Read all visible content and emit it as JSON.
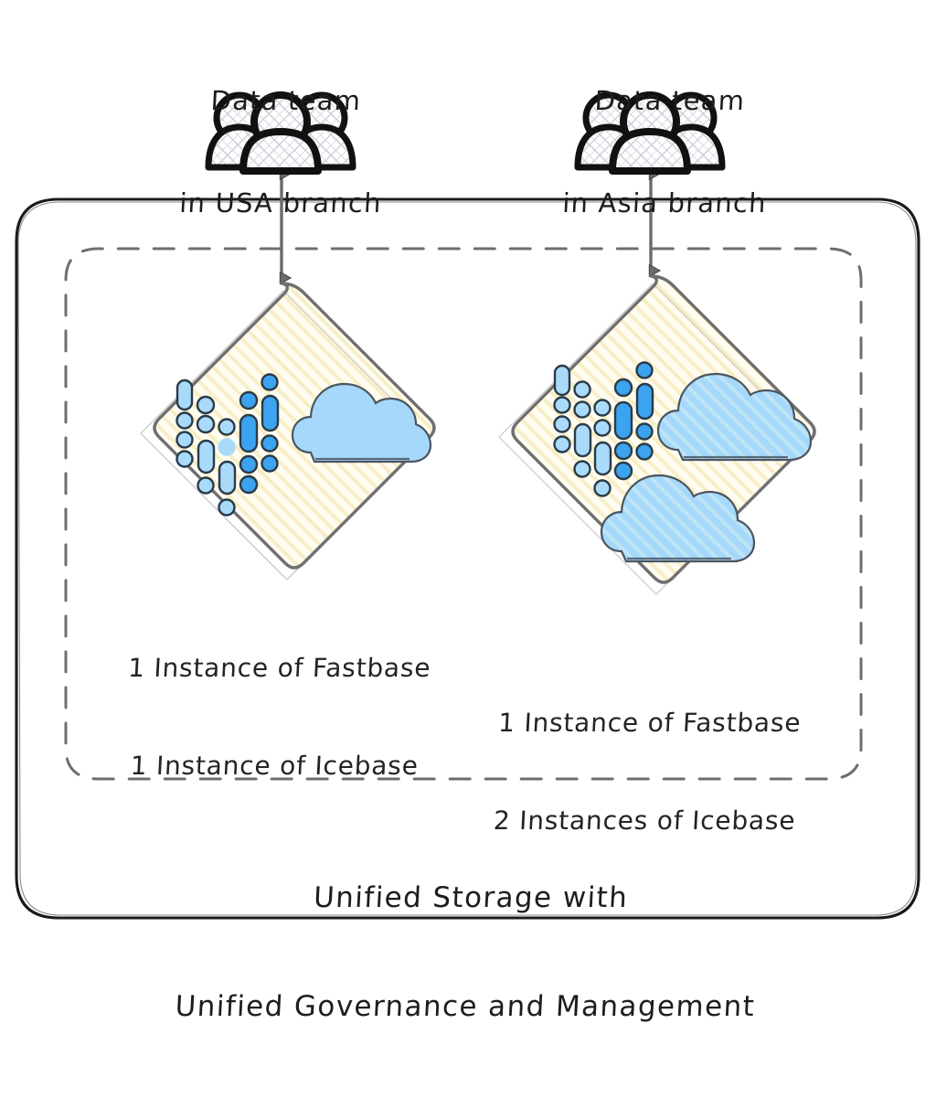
{
  "diagram": {
    "title_caption": {
      "line1": "Unified Storage with",
      "line2": "Unified Governance and Management"
    },
    "teams": [
      {
        "id": "usa",
        "icon": "people-group-icon",
        "label_line1": "Data team",
        "label_line2": "in USA branch"
      },
      {
        "id": "asia",
        "icon": "people-group-icon",
        "label_line1": "Data team",
        "label_line2": "in Asia branch"
      }
    ],
    "regions": [
      {
        "id": "usa",
        "shape": "diamond",
        "icons": [
          "data-dots-icon",
          "cloud-icon"
        ],
        "cloud_count": 1,
        "instances_line1": "1 Instance of Fastbase",
        "instances_line2": "1 Instance of Icebase"
      },
      {
        "id": "asia",
        "shape": "diamond",
        "icons": [
          "data-dots-icon",
          "cloud-icon",
          "cloud-icon"
        ],
        "cloud_count": 2,
        "instances_line1": "1 Instance of Fastbase",
        "instances_line2": "2 Instances of Icebase"
      }
    ],
    "connectors": [
      {
        "id": "usa-connector",
        "style": "double-headed-arrow",
        "from": "team-usa",
        "to": "region-usa"
      },
      {
        "id": "asia-connector",
        "style": "double-headed-arrow",
        "from": "team-asia",
        "to": "region-asia"
      }
    ],
    "containers": {
      "outer": {
        "id": "unified-storage-boundary",
        "border": "solid"
      },
      "inner": {
        "id": "instances-boundary",
        "border": "dashed"
      }
    },
    "colors": {
      "diamond_fill": "#fffdf2",
      "diamond_hatch": "#f6e7b4",
      "diamond_stroke": "#6f6f6f",
      "cloud_fill": "#a5d8fb",
      "cloud_stroke": "#4b5560",
      "data_dot_light": "#a9daf9",
      "data_dot_dark": "#3ba3ef",
      "data_dot_stroke": "#2b3b48",
      "outer_border": "#1a1a1a",
      "inner_border": "#6e6e6e",
      "arrow": "#6b6b6b",
      "text": "#1d1d1d",
      "background": "#ffffff"
    }
  }
}
